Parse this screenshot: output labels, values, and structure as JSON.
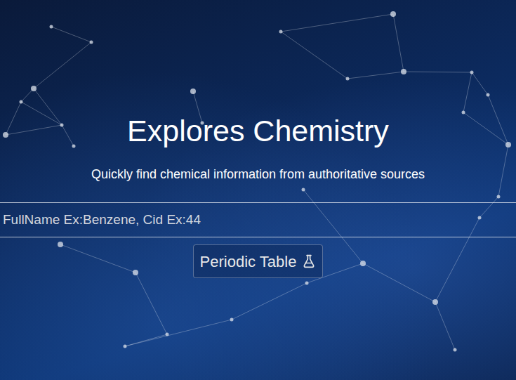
{
  "hero": {
    "title": "Explores Chemistry",
    "subtitle": "Quickly find chemical information from authoritative sources",
    "search": {
      "placeholder": "FullName Ex:Benzene, Cid Ex:44"
    },
    "button": {
      "label": "Periodic Table"
    }
  }
}
